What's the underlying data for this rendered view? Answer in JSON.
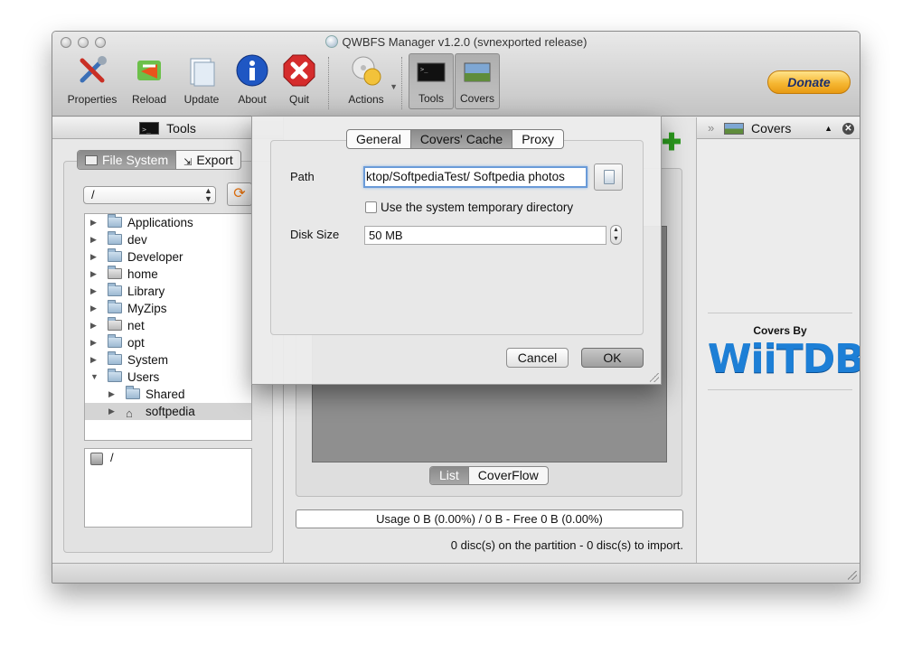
{
  "window": {
    "title": "QWBFS Manager v1.2.0 (svnexported release)"
  },
  "toolbar": {
    "properties": "Properties",
    "reload": "Reload",
    "update": "Update",
    "about": "About",
    "quit": "Quit",
    "actions": "Actions",
    "tools": "Tools",
    "covers": "Covers",
    "donate": "Donate"
  },
  "left_panel": {
    "header": "Tools",
    "tabs": [
      "File System",
      "Export"
    ],
    "path_value": "/",
    "tree": [
      {
        "label": "Applications",
        "level": 0,
        "expanded": false,
        "selected": false,
        "icon": "folder-icon"
      },
      {
        "label": "dev",
        "level": 0,
        "expanded": false,
        "selected": false,
        "icon": "folder-icon"
      },
      {
        "label": "Developer",
        "level": 0,
        "expanded": false,
        "selected": false,
        "icon": "folder-icon"
      },
      {
        "label": "home",
        "level": 0,
        "expanded": false,
        "selected": false,
        "icon": "network-folder-icon"
      },
      {
        "label": "Library",
        "level": 0,
        "expanded": false,
        "selected": false,
        "icon": "folder-icon"
      },
      {
        "label": "MyZips",
        "level": 0,
        "expanded": false,
        "selected": false,
        "icon": "folder-icon"
      },
      {
        "label": "net",
        "level": 0,
        "expanded": false,
        "selected": false,
        "icon": "network-folder-icon"
      },
      {
        "label": "opt",
        "level": 0,
        "expanded": false,
        "selected": false,
        "icon": "folder-icon"
      },
      {
        "label": "System",
        "level": 0,
        "expanded": false,
        "selected": false,
        "icon": "folder-icon"
      },
      {
        "label": "Users",
        "level": 0,
        "expanded": true,
        "selected": false,
        "icon": "folder-icon"
      },
      {
        "label": "Shared",
        "level": 1,
        "expanded": false,
        "selected": false,
        "icon": "folder-icon"
      },
      {
        "label": "softpedia",
        "level": 1,
        "expanded": false,
        "selected": true,
        "icon": "home-icon"
      }
    ],
    "drives": [
      "/"
    ]
  },
  "center": {
    "view_tabs": [
      "List",
      "CoverFlow"
    ],
    "usage": "Usage 0 B (0.00%) / 0 B - Free 0 B (0.00%)",
    "disc_count": "0 disc(s) on the partition - 0 disc(s) to import."
  },
  "right_panel": {
    "header": "Covers",
    "covers_by": "Covers By",
    "logo_text": "WiiTDB"
  },
  "dialog": {
    "tabs": [
      "General",
      "Covers' Cache",
      "Proxy"
    ],
    "active_tab": "Covers' Cache",
    "path_label": "Path",
    "path_value": "ktop/SoftpediaTest/ Softpedia photos",
    "temp_dir_label": "Use the system temporary directory",
    "temp_dir_checked": false,
    "disk_size_label": "Disk Size",
    "disk_size_value": "50 MB",
    "cancel": "Cancel",
    "ok": "OK"
  },
  "colors": {
    "accent_blue": "#1d7fd6",
    "donate_orange": "#f6b733",
    "plus_green": "#2b9a1d"
  }
}
